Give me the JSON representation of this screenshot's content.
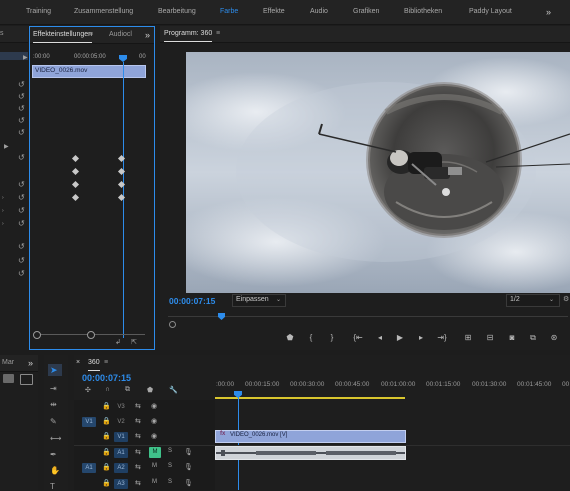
{
  "workspaces": {
    "items": [
      "Training",
      "Zusammenstellung",
      "Bearbeitung",
      "Farbe",
      "Effekte",
      "Audio",
      "Grafiken",
      "Bibliotheken",
      "Paddy Layout"
    ],
    "active": "Farbe",
    "overflow": "»"
  },
  "effect_panel": {
    "tab_left_partial": "s",
    "tab_active": "Effekteinstellungen",
    "tab_menu": "≡",
    "tab_other": "Audiocl",
    "overflow": "»",
    "time_start": ":00:00",
    "time_mid": "00:00:05:00",
    "time_end": "00",
    "clip_name": "VIDEO_0026.mov"
  },
  "program_monitor": {
    "title": "Programm: 360",
    "title_menu": "≡",
    "timecode": "00:00:07:15",
    "fit_label": "Einpassen",
    "resolution": "1/2"
  },
  "project_panel": {
    "tab_label": "Mar",
    "overflow": "»"
  },
  "timeline": {
    "sequence_tab": "360",
    "tab_menu": "≡",
    "close": "×",
    "timecode": "00:00:07:15",
    "ruler_labels": [
      ":00:00",
      "00:00:15:00",
      "00:00:30:00",
      "00:00:45:00",
      "00:01:00:00",
      "00:01:15:00",
      "00:01:30:00",
      "00:01:45:00",
      "00"
    ],
    "tracks": {
      "v3": "V3",
      "v2": "V2",
      "v1": "V1",
      "a1": "A1",
      "a2": "A2",
      "a3": "A3",
      "src_v1": "V1",
      "src_a1": "A1",
      "m": "M",
      "s": "S"
    },
    "video_clip": "VIDEO_0026.mov [V]",
    "fx_badge": "fx"
  },
  "colors": {
    "accent": "#2d8ceb",
    "clip_video": "#8fa4d9",
    "panel_bg": "#1e1e1e",
    "track_active": "#25476d",
    "mute_on": "#3fc28a"
  }
}
